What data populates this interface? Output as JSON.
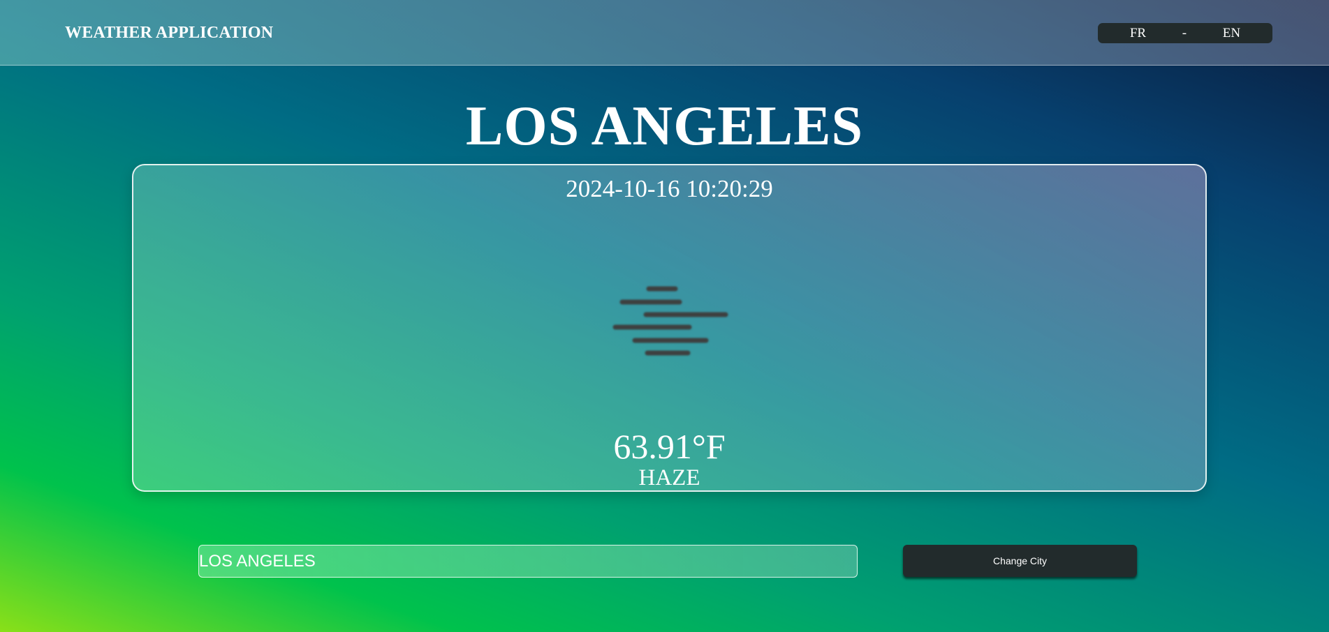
{
  "header": {
    "app_title": "WEATHER APPLICATION",
    "languages": {
      "fr": "FR",
      "separator": "-",
      "en": "EN"
    }
  },
  "main": {
    "city_name": "LOS ANGELES",
    "datetime": "2024-10-16 10:20:29",
    "weather_icon": "haze-icon",
    "temperature": "63.91°F",
    "condition": "HAZE"
  },
  "search": {
    "city_value": "LOS ANGELES",
    "change_button_label": "Change City"
  },
  "colors": {
    "button_bg": "#222b2c",
    "text": "#ffffff",
    "icon_stroke": "#3c3f3f"
  }
}
